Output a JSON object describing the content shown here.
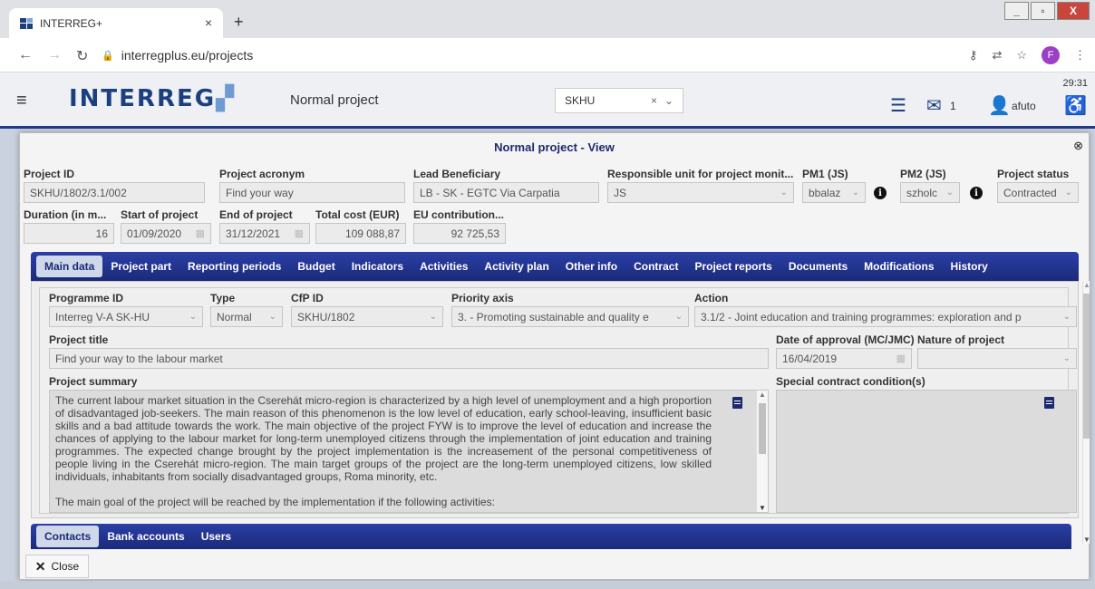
{
  "browser": {
    "tab_title": "INTERREG+",
    "tab_close": "×",
    "new_tab": "+",
    "url": "interregplus.eu/projects",
    "profile_initial": "F",
    "win_min": "_",
    "win_max": "▫",
    "win_close": "X"
  },
  "app": {
    "logo_main": "INTERREG",
    "logo_mark": "■",
    "page_title": "Normal project",
    "programme_select": "SKHU",
    "timer": "29:31",
    "messages_count": "1",
    "username": "afuto"
  },
  "modal": {
    "title": "Normal project - View",
    "fields": {
      "project_id_label": "Project ID",
      "project_id": "SKHU/1802/3.1/002",
      "acronym_label": "Project acronym",
      "acronym": "Find your way",
      "lead_label": "Lead Beneficiary",
      "lead": "LB - SK - EGTC Via Carpatia",
      "resp_label": "Responsible unit for project monit...",
      "resp": "JS",
      "pm1_label": "PM1 (JS)",
      "pm1": "bbalaz",
      "pm2_label": "PM2 (JS)",
      "pm2": "szholc",
      "status_label": "Project status",
      "status": "Contracted",
      "duration_label": "Duration (in m...",
      "duration": "16",
      "start_label": "Start of project",
      "start": "01/09/2020",
      "end_label": "End of project",
      "end": "31/12/2021",
      "total_label": "Total cost (EUR)",
      "total": "109 088,87",
      "eu_label": "EU contribution...",
      "eu": "92 725,53"
    },
    "tabs": [
      "Main data",
      "Project part",
      "Reporting periods",
      "Budget",
      "Indicators",
      "Activities",
      "Activity plan",
      "Other info",
      "Contract",
      "Project reports",
      "Documents",
      "Modifications",
      "History"
    ],
    "main": {
      "programme_label": "Programme ID",
      "programme": "Interreg V-A SK-HU",
      "type_label": "Type",
      "type": "Normal",
      "cfp_label": "CfP ID",
      "cfp": "SKHU/1802",
      "priority_label": "Priority axis",
      "priority": "3. - Promoting sustainable and quality e",
      "action_label": "Action",
      "action": "3.1/2 - Joint education and training programmes: exploration and p",
      "title_label": "Project title",
      "title": "Find your way to the labour market",
      "approval_label": "Date of approval (MC/JMC)",
      "approval": "16/04/2019",
      "nature_label": "Nature of project",
      "nature": "",
      "summary_label": "Project summary",
      "summary_p1": "The current labour market situation in the Cserehát micro-region is characterized by a high level of unemployment and a high proportion of disadvantaged job-seekers. The main reason of this phenomenon is the low level of education, early school-leaving, insufficient basic skills and a bad attitude towards the work. The main objective of the project FYW is to improve the level of education and increase the chances of applying to the labour market for long-term unemployed citizens through the implementation of joint education and training programmes. The expected change brought by the project implementation is the increasement of the personal competitiveness of people living in the Cserehát micro-region. The main target groups of the project are the long-term unemployed citizens, low skilled individuals, inhabitants from socially disadvantaged groups, Roma minority, etc.",
      "summary_p2": "The main goal of the project will be reached by the implementation if the following activities:",
      "special_label": "Special contract condition(s)"
    },
    "bottom_tabs": [
      "Contacts",
      "Bank accounts",
      "Users"
    ],
    "close_label": "Close"
  }
}
